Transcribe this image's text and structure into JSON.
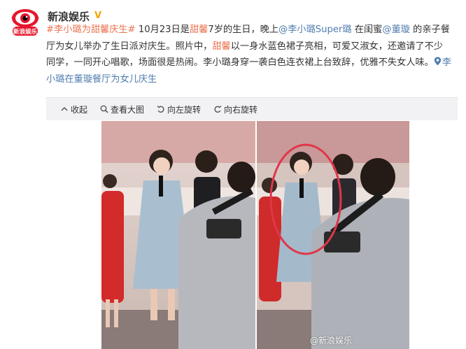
{
  "account": {
    "name": "新浪娱乐",
    "verified_badge": "V",
    "avatar_text": "新浪娱乐"
  },
  "post": {
    "tag1": "#李小璐为",
    "tag1_name": "甜馨",
    "tag1_end": "庆生#",
    "t1": " 10月23日是",
    "n1": "甜馨",
    "t2": "7岁的生日，晚上",
    "mention1": "@李小璐Super璐",
    "t3": " 在闺蜜",
    "mention2": "@董璇",
    "t4": " 的亲子餐厅为女儿举办了生日派对庆生。照片中，",
    "n2": "甜馨",
    "t5": "以一身水蓝色裙子亮相，可爱又淑女，还邀请了不少同学，一同开心唱歌，场面很是热闹。李小璐身穿一袭白色连衣裙上台致辞，优雅不失女人味。",
    "location": "李小璐在董璇餐厅为女儿庆生"
  },
  "toolbar": {
    "collapse": "收起",
    "view_large": "查看大图",
    "rotate_left": "向左旋转",
    "rotate_right": "向右旋转"
  },
  "photo": {
    "watermark": "@新浪娱乐"
  },
  "colors": {
    "link": "#eb7350",
    "mention": "#507daf",
    "highlight_circle": "#e0364b"
  }
}
